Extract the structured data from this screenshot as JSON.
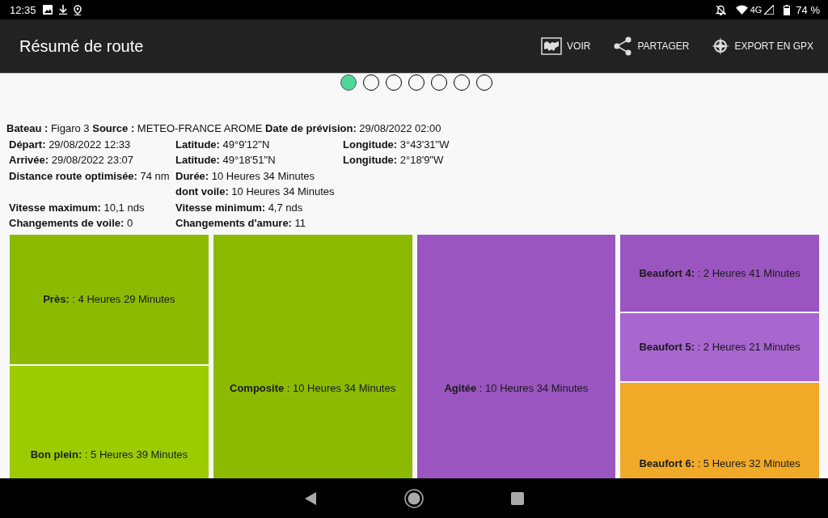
{
  "status_bar": {
    "time": "12:35",
    "network": "4G",
    "battery": "74 %"
  },
  "app_bar": {
    "title": "Résumé de route",
    "actions": [
      {
        "kind": "map",
        "label": "VOIR"
      },
      {
        "kind": "share",
        "label": "PARTAGER"
      },
      {
        "kind": "compass",
        "label": "EXPORT EN GPX"
      }
    ]
  },
  "pager": [
    {
      "selected": true
    },
    {
      "selected": false
    },
    {
      "selected": false
    },
    {
      "selected": false
    },
    {
      "selected": false
    },
    {
      "selected": false
    },
    {
      "selected": false
    }
  ],
  "summary": {
    "header": "**Bateau :** Figaro 3 **Source :** METEO-FRANCE AROME **Date de prévision:** 29/08/2022 02:00",
    "rows": [
      [
        "**Départ:** 29/08/2022 12:33",
        "**Latitude:** 49°9'12\"N",
        "**Longitude:** 3°43'31\"W"
      ],
      [
        "**Arrivée:** 29/08/2022 23:07",
        "**Latitude:** 49°18'51\"N",
        "**Longitude:** 2°18'9\"W"
      ],
      [
        "**Distance route optimisée:** 74 nm",
        "**Durée:** 10 Heures 34 Minutes",
        ""
      ],
      [
        "",
        "**dont voile:** 10 Heures 34 Minutes",
        ""
      ],
      [
        "**Vitesse maximum:** 10,1 nds",
        "**Vitesse minimum:** 4,7 nds",
        ""
      ],
      [
        "**Changements de voile:** 0",
        "**Changements d'amure:** 11",
        ""
      ]
    ]
  },
  "treemap": [
    [
      {
        "text": "**Près:** : 4 Heures 29 Minutes",
        "color": "#8cba00"
      },
      {
        "text": "**Bon plein:** : 5 Heures 39 Minutes",
        "color": "#9ccc00"
      }
    ],
    [
      {
        "text": "**Composite** : 10 Heures 34 Minutes",
        "color": "#8cba00"
      }
    ],
    [
      {
        "text": "**Agitée** : 10 Heures 34 Minutes",
        "color": "#9a55c0"
      }
    ],
    [
      {
        "text": "**Beaufort 4:** : 2 Heures 41 Minutes",
        "color": "#9a55c0"
      },
      {
        "text": "**Beaufort 5:** : 2 Heures 21 Minutes",
        "color": "#a866cf"
      },
      {
        "text": "**Beaufort 6:** : 5 Heures 32 Minutes",
        "color": "#f0aa28"
      }
    ]
  ]
}
